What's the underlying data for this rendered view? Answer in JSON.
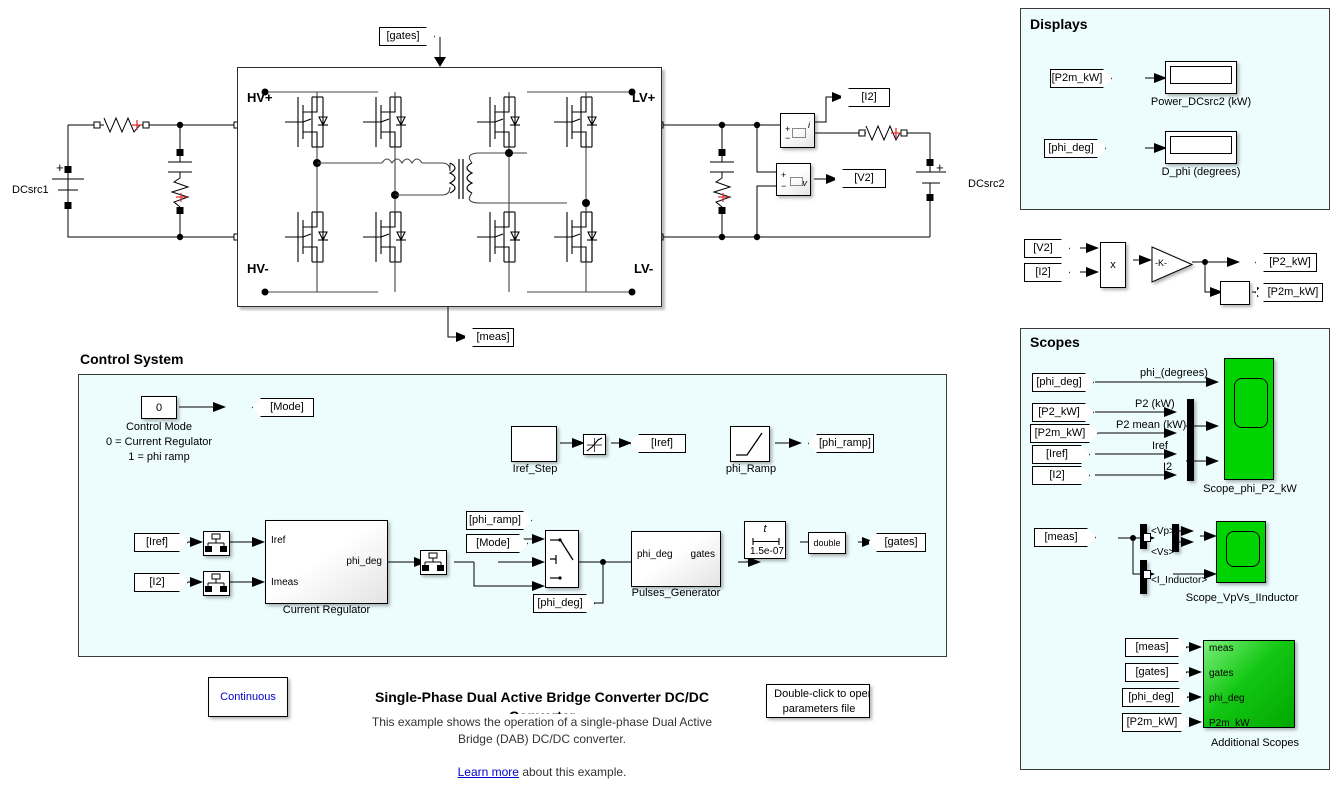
{
  "power_circuit": {
    "source_left_label": "DCsrc1",
    "source_right_label": "DCsrc2",
    "bridge_terminals": [
      "HV+",
      "HV-",
      "LV+",
      "LV-"
    ],
    "tags": {
      "gates_in": "[gates]",
      "meas_out": "[meas]",
      "i2_out": "[I2]",
      "v2_out": "[V2]"
    },
    "plus_signs": [
      "+",
      "+"
    ]
  },
  "displays_panel": {
    "title": "Displays",
    "rows": [
      {
        "tag": "[P2m_kW]",
        "caption": "Power_DCsrc2 (kW)",
        "value": ""
      },
      {
        "tag": "[phi_deg]",
        "caption": "D_phi (degrees)",
        "value": ""
      }
    ]
  },
  "power_calc": {
    "inputs": [
      "[V2]",
      "[I2]"
    ],
    "product_symbol": "x",
    "gain_label": "-K-",
    "mean_block_label": "",
    "outputs": [
      "[P2_kW]",
      "[P2m_kW]"
    ]
  },
  "scopes_panel": {
    "title": "Scopes",
    "scope1": {
      "name": "Scope_phi_P2_kW",
      "inputs": [
        {
          "tag": "[phi_deg]",
          "signal": "phi_(degrees)"
        },
        {
          "tag": "[P2_kW]",
          "signal": "P2 (kW)"
        },
        {
          "tag": "[P2m_kW]",
          "signal": "P2 mean (kW)"
        },
        {
          "tag": "[Iref]",
          "signal": "Iref"
        },
        {
          "tag": "[I2]",
          "signal": "I2"
        }
      ]
    },
    "scope2": {
      "name": "Scope_VpVs_IInductor",
      "input_tag": "[meas]",
      "selector_signals": [
        "<Vp>",
        "<Vs>",
        "<I_Inductor>"
      ]
    },
    "scope3": {
      "name": "Additional Scopes",
      "inputs": [
        {
          "tag": "[meas]",
          "port": "meas"
        },
        {
          "tag": "[gates]",
          "port": "gates"
        },
        {
          "tag": "[phi_deg]",
          "port": "phi_deg"
        },
        {
          "tag": "[P2m_kW]",
          "port": "P2m_kW"
        }
      ]
    }
  },
  "control_system": {
    "title": "Control System",
    "mode_constant": "0",
    "mode_caption_line1": "Control Mode",
    "mode_caption_line2": "0 = Current Regulator",
    "mode_caption_line3": "1 = phi ramp",
    "mode_goto": "[Mode]",
    "iref_step_name": "Iref_Step",
    "iref_goto": "[Iref]",
    "phi_ramp_name": "phi_Ramp",
    "phi_ramp_goto": "[phi_ramp]",
    "regulator": {
      "name": "Current Regulator",
      "in_ports": [
        "Iref",
        "Imeas"
      ],
      "out_port": "phi_deg",
      "from_tags": [
        "[Iref]",
        "[I2]"
      ]
    },
    "switch_inputs": [
      "[phi_ramp]",
      "[Mode]"
    ],
    "phi_deg_goto": "[phi_deg]",
    "pulses_generator": {
      "name": "Pulses_Generator",
      "in_port": "phi_deg",
      "out_port": "gates"
    },
    "delay_block": {
      "top": "t",
      "bottom": "1.5e-07"
    },
    "convert_block": "double",
    "gates_goto": "[gates]"
  },
  "footer": {
    "solver_block": "Continuous",
    "title": "Single-Phase Dual Active Bridge Converter DC/DC Converter",
    "description_line1": "This example shows the operation of a single-phase Dual Active",
    "description_line2": "Bridge (DAB) DC/DC converter.",
    "learn_more_link": "Learn more",
    "learn_more_rest": " about this example.",
    "params_block_line1": "Double-click to open",
    "params_block_line2": "parameters file"
  },
  "colors": {
    "panel_bg": "#edfcfd",
    "panel_border": "#3a3a3a",
    "scope_green": "#00d400",
    "link_blue": "#0000cc",
    "solver_text": "#0000cc",
    "accent_red": "#e03030"
  }
}
